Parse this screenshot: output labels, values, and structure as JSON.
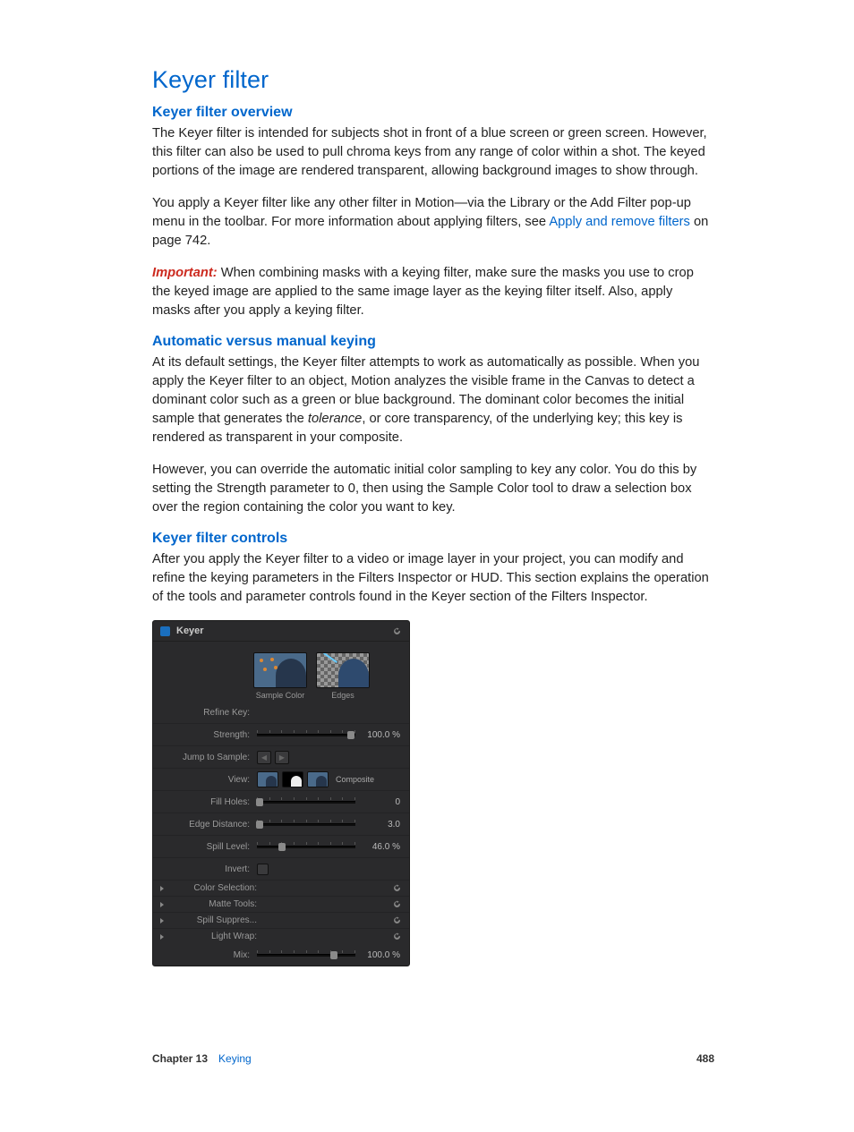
{
  "heading_main": "Keyer filter",
  "sections": {
    "overview": {
      "title": "Keyer filter overview",
      "p1": "The Keyer filter is intended for subjects shot in front of a blue screen or green screen. However, this filter can also be used to pull chroma keys from any range of color within a shot. The keyed portions of the image are rendered transparent, allowing background images to show through.",
      "p2_a": "You apply a Keyer filter like any other filter in Motion—via the Library or the Add Filter pop-up menu in the toolbar. For more information about applying filters, see ",
      "p2_link": "Apply and remove filters",
      "p2_b": " on page 742.",
      "important_label": "Important:  ",
      "important_text": "When combining masks with a keying filter, make sure the masks you use to crop the keyed image are applied to the same image layer as the keying filter itself. Also, apply masks after you apply a keying filter."
    },
    "auto": {
      "title": "Automatic versus manual keying",
      "p1_a": "At its default settings, the Keyer filter attempts to work as automatically as possible. When you apply the Keyer filter to an object, Motion analyzes the visible frame in the Canvas to detect a dominant color such as a green or blue background. The dominant color becomes the initial sample that generates the ",
      "p1_em": "tolerance",
      "p1_b": ", or core transparency, of the underlying key; this key is rendered as transparent in your composite.",
      "p2": "However, you can override the automatic initial color sampling to key any color. You do this by setting the Strength parameter to 0, then using the Sample Color tool to draw a selection box over the region containing the color you want to key."
    },
    "controls": {
      "title": "Keyer filter controls",
      "p1": "After you apply the Keyer filter to a video or image layer in your project, you can modify and refine the keying parameters in the Filters Inspector or HUD. This section explains the operation of the tools and parameter controls found in the Keyer section of the Filters Inspector."
    }
  },
  "panel": {
    "title": "Keyer",
    "refine_key_label": "Refine Key:",
    "sample_color": "Sample Color",
    "edges": "Edges",
    "strength_label": "Strength:",
    "strength_value": "100.0 %",
    "jump_label": "Jump to Sample:",
    "view_label": "View:",
    "view_mode": "Composite",
    "fill_holes_label": "Fill Holes:",
    "fill_holes_value": "0",
    "edge_distance_label": "Edge Distance:",
    "edge_distance_value": "3.0",
    "spill_level_label": "Spill Level:",
    "spill_level_value": "46.0 %",
    "invert_label": "Invert:",
    "color_selection_label": "Color Selection:",
    "matte_tools_label": "Matte Tools:",
    "spill_suppress_label": "Spill Suppres...",
    "light_wrap_label": "Light Wrap:",
    "mix_label": "Mix:",
    "mix_value": "100.0 %",
    "slider_positions": {
      "strength": 95,
      "fill": 3,
      "edge": 3,
      "spill": 25,
      "mix": 78
    }
  },
  "footer": {
    "chapter": "Chapter 13",
    "chapter_name": "Keying",
    "page": "488"
  }
}
